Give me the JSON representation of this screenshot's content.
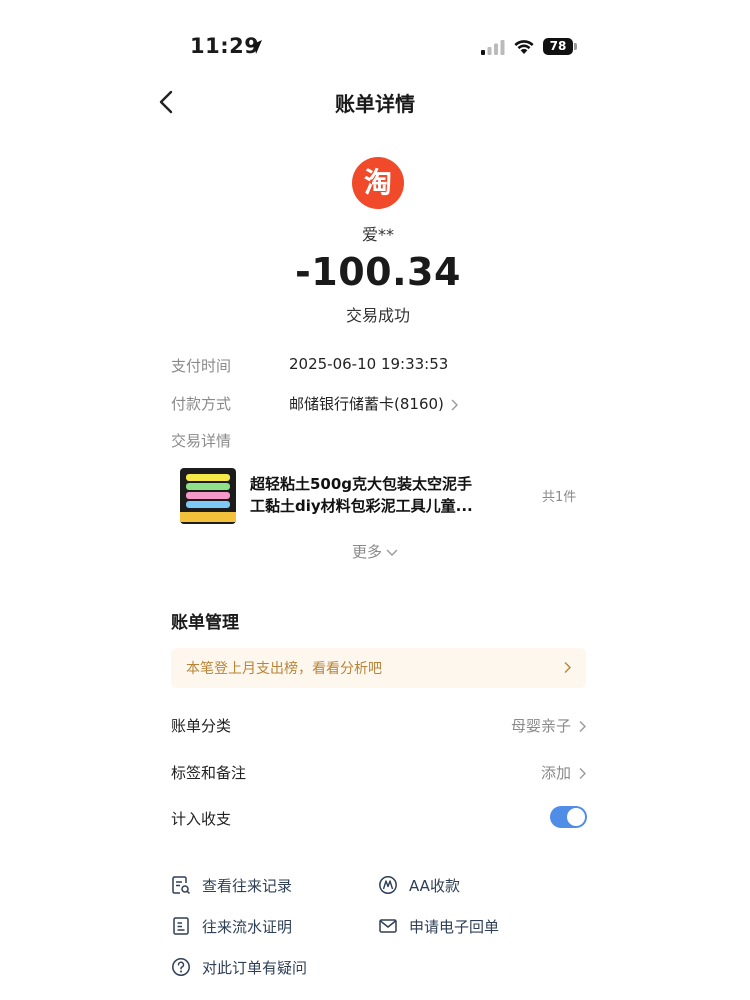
{
  "status_bar": {
    "time": "11:29",
    "battery": "78"
  },
  "header": {
    "title": "账单详情"
  },
  "merchant": {
    "logo_text": "淘",
    "name": "爱**",
    "amount": "-100.34",
    "status": "交易成功"
  },
  "details": {
    "pay_time_label": "支付时间",
    "pay_time_value": "2025-06-10 19:33:53",
    "pay_method_label": "付款方式",
    "pay_method_value": "邮储银行储蓄卡(8160)",
    "trade_detail_label": "交易详情"
  },
  "product": {
    "title_line1": "超轻粘土500g克大包装太空泥手",
    "title_line2": "工黏土diy材料包彩泥工具儿童...",
    "count": "共1件"
  },
  "more_label": "更多",
  "bill_management": {
    "title": "账单管理",
    "promo_text": "本笔登上月支出榜，看看分析吧",
    "category_label": "账单分类",
    "category_value": "母婴亲子",
    "tags_label": "标签和备注",
    "tags_value": "添加",
    "include_label": "计入收支",
    "include_enabled": true
  },
  "actions": {
    "history": "查看往来记录",
    "aa": "AA收款",
    "statement": "往来流水证明",
    "receipt": "申请电子回单",
    "question": "对此订单有疑问"
  },
  "colors": {
    "taobao_red": "#f04a2a",
    "promo_text": "#b8843a",
    "toggle_on": "#4f8de6",
    "action_text": "#2e3f56"
  }
}
